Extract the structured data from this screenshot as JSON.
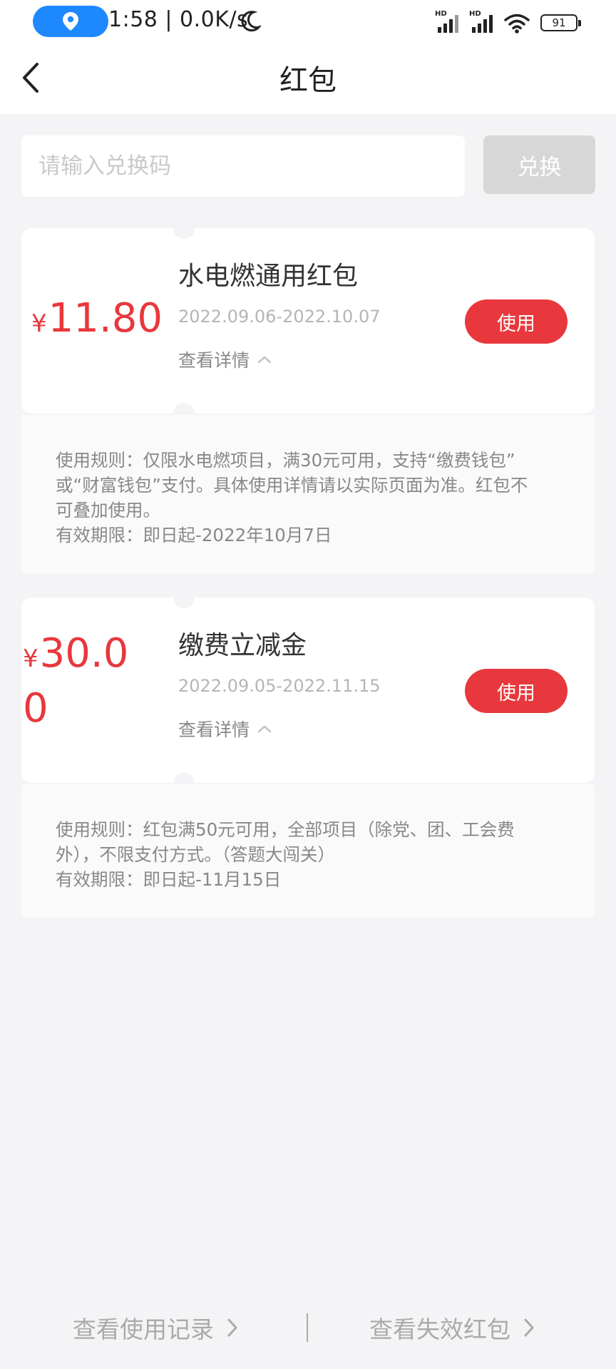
{
  "status_bar": {
    "time": "1:58 | 0.0K/s",
    "hd_1": "HD",
    "hd_2": "HD",
    "battery": "91"
  },
  "header": {
    "title": "红包"
  },
  "redeem": {
    "placeholder": "请输入兑换码",
    "button_label": "兑换"
  },
  "coupons": [
    {
      "currency": "¥",
      "amount": "11.80",
      "title": "水电燃通用红包",
      "date_range": "2022.09.06-2022.10.07",
      "detail_label": "查看详情",
      "use_label": "使用",
      "rule_lines": [
        "使用规则：仅限水电燃项目，满30元可用，支持“缴费钱包”",
        "或“财富钱包”支付。具体使用详情请以实际页面为准。红包不",
        "可叠加使用。",
        "有效期限：即日起-2022年10月7日"
      ]
    },
    {
      "currency": "¥",
      "amount_line1": "30.0",
      "amount_line2": "0",
      "title": "缴费立减金",
      "date_range": "2022.09.05-2022.11.15",
      "detail_label": "查看详情",
      "use_label": "使用",
      "rule_lines": [
        "使用规则：红包满50元可用，全部项目（除党、团、工会费",
        "外），不限支付方式。（答题大闯关）",
        "有效期限：即日起-11月15日"
      ]
    }
  ],
  "footer": {
    "history_label": "查看使用记录",
    "expired_label": "查看失效红包"
  },
  "colors": {
    "accent_red": "#e8383d",
    "page_background": "#f4f4f6",
    "disabled_button": "#d7d7d7",
    "location_pill": "#1e88ff"
  },
  "icons": [
    "location-pin-icon",
    "moon-icon",
    "signal-icon",
    "wifi-icon",
    "battery-icon",
    "back-arrow-icon",
    "chevron-up-icon",
    "chevron-right-icon"
  ]
}
